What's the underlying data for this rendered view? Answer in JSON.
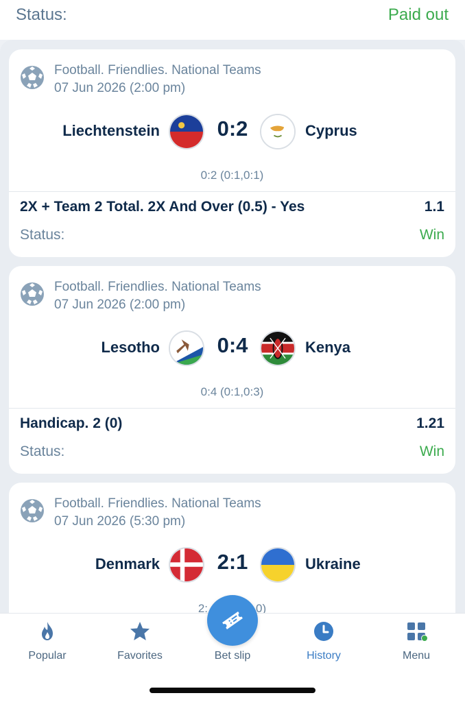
{
  "header": {
    "status_label": "Status:",
    "status_value": "Paid out"
  },
  "colors": {
    "win": "#3cab4e",
    "accent": "#3f8fdd",
    "text_dark": "#0f2a4a",
    "text_muted": "#6a849c"
  },
  "bets": [
    {
      "league": "Football. Friendlies. National Teams",
      "date": "07 Jun 2026 (2:00 pm)",
      "team1": "Liechtenstein",
      "team2": "Cyprus",
      "score": "0:2",
      "subscore": "0:2 (0:1,0:1)",
      "bet_name": "2X + Team 2 Total. 2X And Over (0.5) - Yes",
      "odds": "1.1",
      "status_label": "Status:",
      "status_value": "Win"
    },
    {
      "league": "Football. Friendlies. National Teams",
      "date": "07 Jun 2026 (2:00 pm)",
      "team1": "Lesotho",
      "team2": "Kenya",
      "score": "0:4",
      "subscore": "0:4 (0:1,0:3)",
      "bet_name": "Handicap. 2 (0)",
      "odds": "1.21",
      "status_label": "Status:",
      "status_value": "Win"
    },
    {
      "league": "Football. Friendlies. National Teams",
      "date": "07 Jun 2026 (5:30 pm)",
      "team1": "Denmark",
      "team2": "Ukraine",
      "score": "2:1",
      "subscore_partial_left": "2:",
      "subscore_partial_right": "0)"
    }
  ],
  "nav": {
    "items": [
      {
        "label": "Popular",
        "icon": "flame-icon"
      },
      {
        "label": "Favorites",
        "icon": "star-icon"
      },
      {
        "label": "Bet slip",
        "icon": "ticket-icon"
      },
      {
        "label": "History",
        "icon": "clock-icon"
      },
      {
        "label": "Menu",
        "icon": "grid-icon"
      }
    ]
  }
}
